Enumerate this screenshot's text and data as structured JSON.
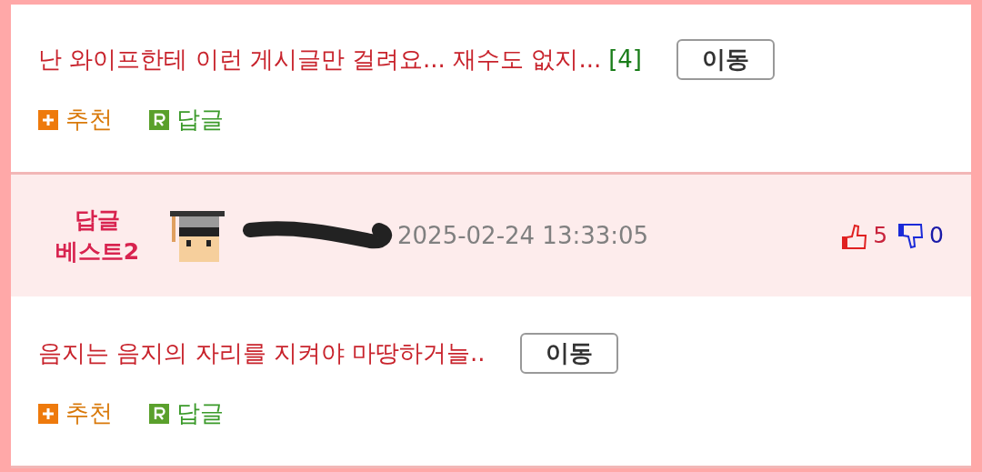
{
  "posts": [
    {
      "kind": "post",
      "title": "난 와이프한테 이런 게시글만 걸려요... 재수도 없지...",
      "comment_count": "[4]",
      "move_button": "이동",
      "recommend": "추천",
      "reply": "답글"
    },
    {
      "kind": "header",
      "badge_lines": [
        "답글",
        "베스트2"
      ],
      "redacted": true,
      "timestamp": "2025-02-24 13:33:05",
      "likes": "5",
      "dislikes": "0"
    },
    {
      "kind": "post",
      "title": "음지는 음지의 자리를 지켜야 마땅하거늘..",
      "move_button": "이동",
      "recommend": "추천",
      "reply": "답글"
    }
  ]
}
